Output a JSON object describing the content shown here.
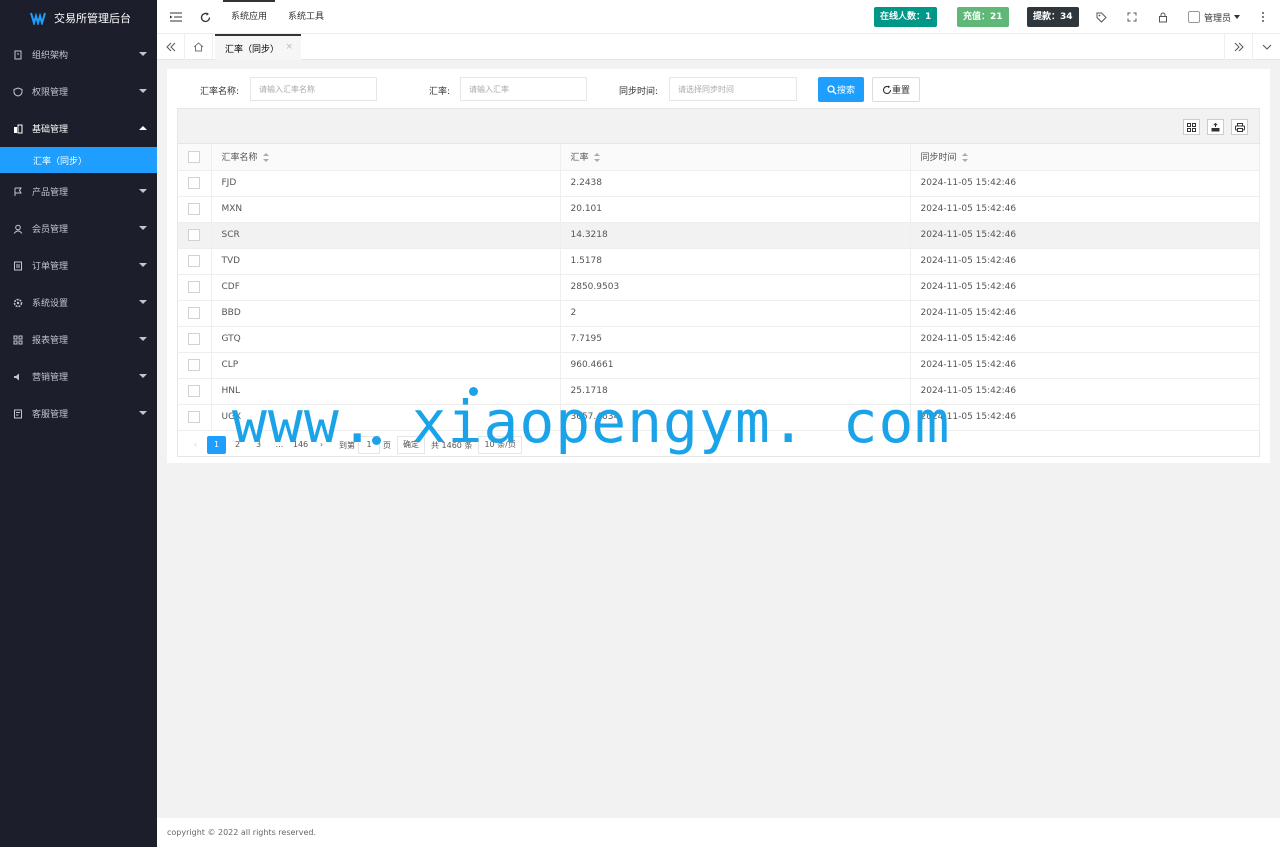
{
  "app": {
    "title": "交易所管理后台"
  },
  "sidebar": {
    "items": [
      {
        "label": "组织架构",
        "icon": "org-icon"
      },
      {
        "label": "权限管理",
        "icon": "shield-icon"
      },
      {
        "label": "基础管理",
        "icon": "base-icon",
        "open": true
      },
      {
        "label": "产品管理",
        "icon": "flag-icon"
      },
      {
        "label": "会员管理",
        "icon": "user-icon"
      },
      {
        "label": "订单管理",
        "icon": "order-icon"
      },
      {
        "label": "系统设置",
        "icon": "gear-icon"
      },
      {
        "label": "报表管理",
        "icon": "report-icon"
      },
      {
        "label": "营销管理",
        "icon": "speaker-icon"
      },
      {
        "label": "客服管理",
        "icon": "service-icon"
      }
    ],
    "active_sub": "汇率（同步）"
  },
  "header": {
    "tabs": [
      "系统应用",
      "系统工具"
    ],
    "badges": [
      {
        "label": "在线人数：1",
        "color": "#009688"
      },
      {
        "label": "充值：21",
        "color": "#5fb878"
      },
      {
        "label": "提款：34",
        "color": "#2f363c"
      }
    ],
    "user": "管理员"
  },
  "tabbar": {
    "current": "汇率（同步）",
    "close": "×"
  },
  "filters": [
    {
      "label": "汇率名称:",
      "placeholder": "请输入汇率名称"
    },
    {
      "label": "汇率:",
      "placeholder": "请输入汇率"
    },
    {
      "label": "同步时间:",
      "placeholder": "请选择同步时间"
    }
  ],
  "buttons": {
    "search": "搜索",
    "reset": "重置"
  },
  "table": {
    "columns": [
      "汇率名称",
      "汇率",
      "同步时间"
    ],
    "rows": [
      [
        "FJD",
        "2.2438",
        "2024-11-05 15:42:46"
      ],
      [
        "MXN",
        "20.101",
        "2024-11-05 15:42:46"
      ],
      [
        "SCR",
        "14.3218",
        "2024-11-05 15:42:46"
      ],
      [
        "TVD",
        "1.5178",
        "2024-11-05 15:42:46"
      ],
      [
        "CDF",
        "2850.9503",
        "2024-11-05 15:42:46"
      ],
      [
        "BBD",
        "2",
        "2024-11-05 15:42:46"
      ],
      [
        "GTQ",
        "7.7195",
        "2024-11-05 15:42:46"
      ],
      [
        "CLP",
        "960.4661",
        "2024-11-05 15:42:46"
      ],
      [
        "HNL",
        "25.1718",
        "2024-11-05 15:42:46"
      ],
      [
        "UGX",
        "3657.4634",
        "2024-11-05 15:42:46"
      ]
    ],
    "highlight_row": 2
  },
  "pager": {
    "pages": [
      "1",
      "2",
      "3",
      "...",
      "146"
    ],
    "current": "1",
    "goto_label": "到第",
    "goto_value": "1",
    "page_unit": "页",
    "confirm": "确定",
    "total": "共 1460 条",
    "per_page": "10 条/页"
  },
  "footer": {
    "copyright": "copyright © 2022 all rights reserved."
  },
  "watermark": "www. xiaopengym. com"
}
